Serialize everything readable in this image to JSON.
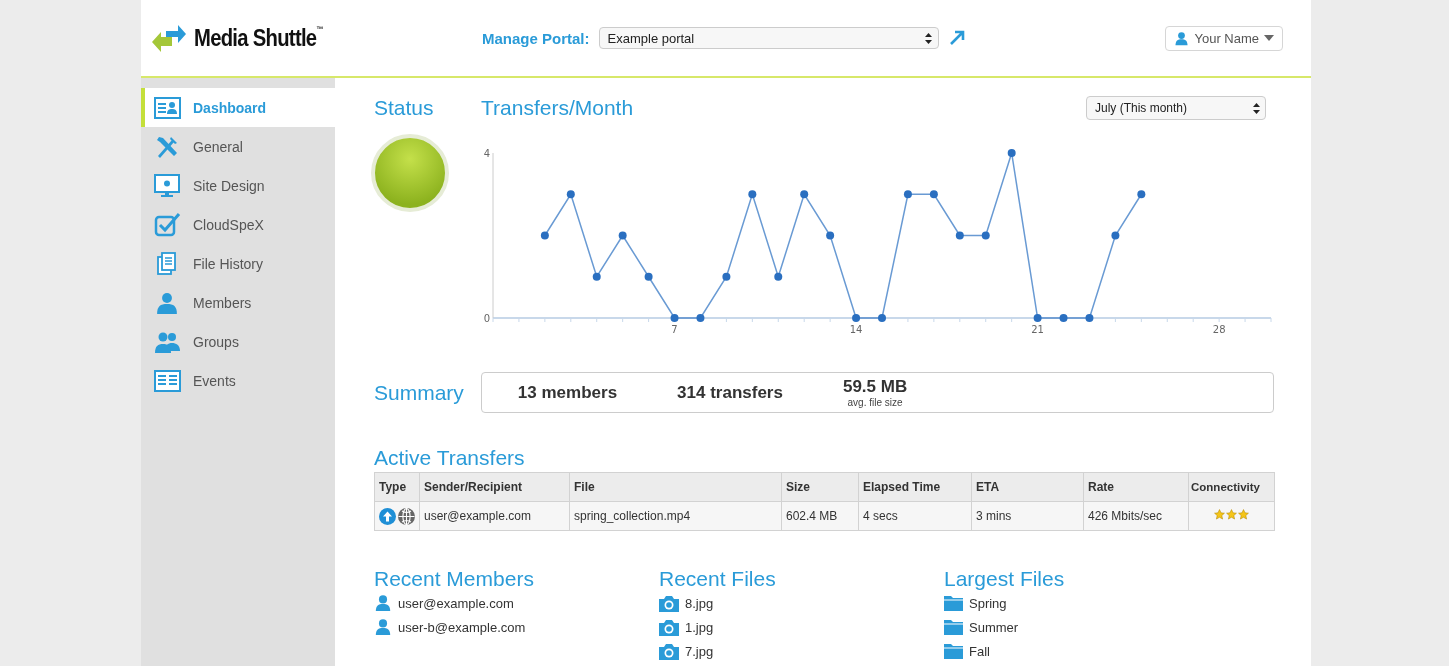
{
  "header": {
    "logo": "Media Shuttle",
    "trademark": "™",
    "portal_label": "Manage Portal:",
    "portal_select": "Example portal",
    "user_menu": "Your Name"
  },
  "sidebar": {
    "items": [
      {
        "label": "Dashboard",
        "selected": true
      },
      {
        "label": "General",
        "selected": false
      },
      {
        "label": "Site Design",
        "selected": false
      },
      {
        "label": "CloudSpeX",
        "selected": false
      },
      {
        "label": "File History",
        "selected": false
      },
      {
        "label": "Members",
        "selected": false
      },
      {
        "label": "Groups",
        "selected": false
      },
      {
        "label": "Events",
        "selected": false
      }
    ]
  },
  "status": {
    "title": "Status"
  },
  "transfers_month": {
    "title": "Transfers/Month",
    "period_select": "July (This month)",
    "chart_data": {
      "type": "line",
      "x": [
        2,
        3,
        4,
        5,
        6,
        7,
        8,
        9,
        10,
        11,
        12,
        13,
        14,
        15,
        16,
        17,
        18,
        19,
        20,
        21,
        22,
        23,
        24,
        25
      ],
      "series": [
        {
          "color": "#2a6fc0",
          "marker": "circle",
          "values": [
            2,
            3,
            1,
            2,
            1,
            0,
            0,
            1,
            3,
            1,
            3,
            2,
            0,
            0,
            3,
            3,
            2,
            2,
            4,
            0,
            0,
            0,
            2,
            3
          ]
        }
      ],
      "xlim": [
        0,
        30
      ],
      "ylim": [
        0,
        4
      ],
      "xticks": [
        7,
        14,
        21,
        28
      ],
      "yticks": [
        0,
        4
      ]
    }
  },
  "summary": {
    "title": "Summary",
    "stats": [
      {
        "value": "13 members"
      },
      {
        "value": "314 transfers"
      },
      {
        "value": "59.5 MB",
        "caption": "avg. file size"
      }
    ]
  },
  "active_transfers": {
    "title": "Active Transfers",
    "columns": [
      "Type",
      "Sender/Recipient",
      "File",
      "Size",
      "Elapsed Time",
      "ETA",
      "Rate",
      "Connectivity"
    ],
    "rows": [
      {
        "cells": [
          "",
          "user@example.com",
          "spring_collection.mp4",
          "602.4 MB",
          "4 secs",
          "3 mins",
          "426 Mbits/sec",
          ""
        ],
        "stars": 3
      }
    ]
  },
  "recent_members": {
    "title": "Recent Members",
    "items": [
      "user@example.com",
      "user-b@example.com"
    ]
  },
  "recent_files": {
    "title": "Recent Files",
    "items": [
      "8.jpg",
      "1.jpg",
      "7.jpg"
    ]
  },
  "largest_files": {
    "title": "Largest Files",
    "items": [
      "Spring",
      "Summer",
      "Fall"
    ]
  }
}
